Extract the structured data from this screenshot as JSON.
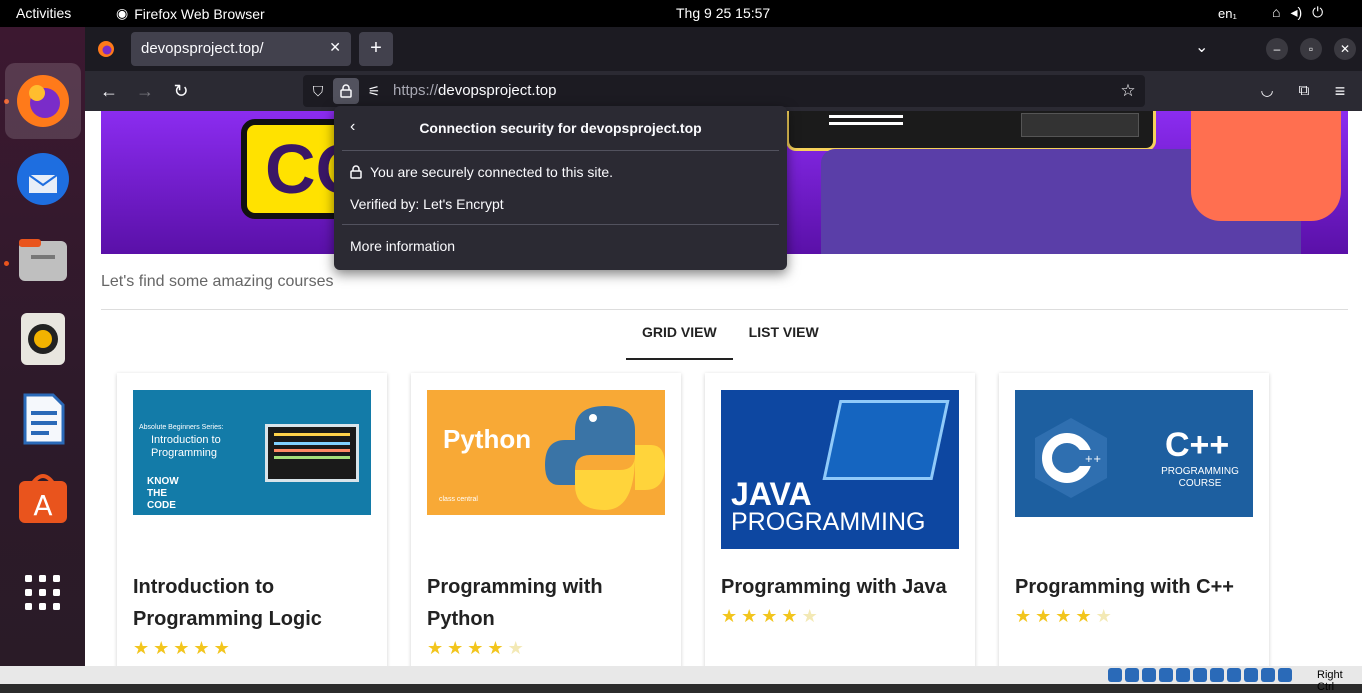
{
  "topbar": {
    "activities": "Activities",
    "app_name": "Firefox Web Browser",
    "clock": "Thg 9 25  15:57",
    "lang": "en₁"
  },
  "browser": {
    "tab_title": "devopsproject.top/",
    "url_protocol": "https://",
    "url_host": "devopsproject.top"
  },
  "security_popup": {
    "title": "Connection security for devopsproject.top",
    "secure_text": "You are securely connected to this site.",
    "verified_by": "Verified by: Let's Encrypt",
    "more_info": "More information"
  },
  "page": {
    "hero_text": "CO",
    "tagline": "Let's find some amazing courses",
    "views": [
      "GRID VIEW",
      "LIST VIEW"
    ],
    "active_view": "GRID VIEW",
    "courses": [
      {
        "title": "Introduction to Programming Logic",
        "thumb_lines": [
          "Absolute Beginners Series:",
          "Introduction to",
          "Programming"
        ],
        "thumb_brand": "KNOW THE CODE",
        "rating": 5
      },
      {
        "title": "Programming with Python",
        "thumb_text": "Python",
        "thumb_brand": "class central",
        "rating": 4
      },
      {
        "title": "Programming with Java",
        "thumb_text1": "JAVA",
        "thumb_text2": "PROGRAMMING",
        "rating": 4
      },
      {
        "title": "Programming with C++",
        "thumb_text1": "C++",
        "thumb_text2": "PROGRAMMING COURSE",
        "rating": 4
      }
    ]
  },
  "statusbar": {
    "right_ctrl": "Right Ctrl"
  },
  "colors": {
    "hero": "#7a1fd8",
    "firefox_dark": "#1c1b22",
    "accent_orange": "#e9541d"
  }
}
